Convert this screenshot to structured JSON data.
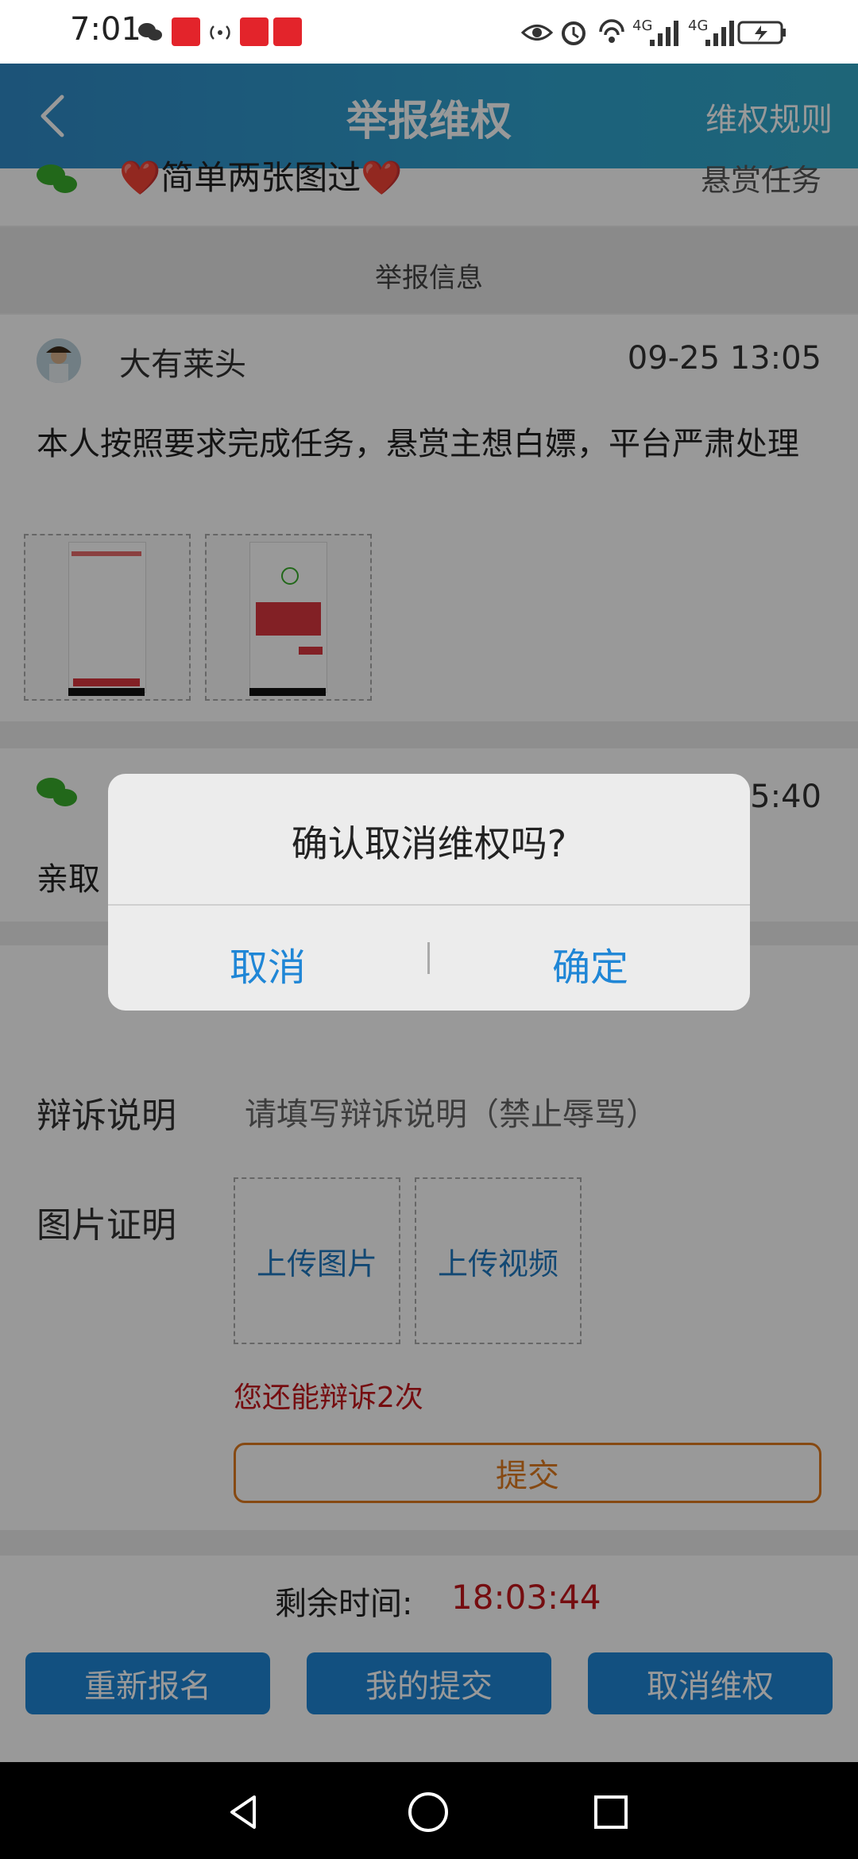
{
  "status": {
    "time": "7:01",
    "network_labels": [
      "4G",
      "4G"
    ]
  },
  "header": {
    "title": "举报维权",
    "right_link": "维权规则"
  },
  "task": {
    "name": "❤️简单两张图过❤️",
    "type": "悬赏任务"
  },
  "section": {
    "report_info_title": "举报信息"
  },
  "report": {
    "username": "大有莱头",
    "datetime": "09-25 13:05",
    "description": "本人按照要求完成任务，悬赏主想白嫖，平台严肃处理",
    "thumbnails": 2
  },
  "reply": {
    "time_partial": "5:40",
    "text_partial": "亲取"
  },
  "appeal": {
    "label": "辩诉说明",
    "placeholder": "请填写辩诉说明（禁止辱骂）",
    "image_label": "图片证明",
    "upload_image": "上传图片",
    "upload_video": "上传视频",
    "remaining_text": "您还能辩诉2次",
    "submit": "提交"
  },
  "footer": {
    "timer_label": "剩余时间:",
    "timer_value": "18:03:44",
    "buttons": [
      "重新报名",
      "我的提交",
      "取消维权"
    ]
  },
  "dialog": {
    "message": "确认取消维权吗?",
    "cancel": "取消",
    "confirm": "确定"
  },
  "colors": {
    "header_start": "#2f8ac8",
    "header_end": "#32a9c9",
    "primary_blue": "#1f86d6",
    "danger_red": "#c4161c",
    "submit_orange": "#e07b1f"
  }
}
